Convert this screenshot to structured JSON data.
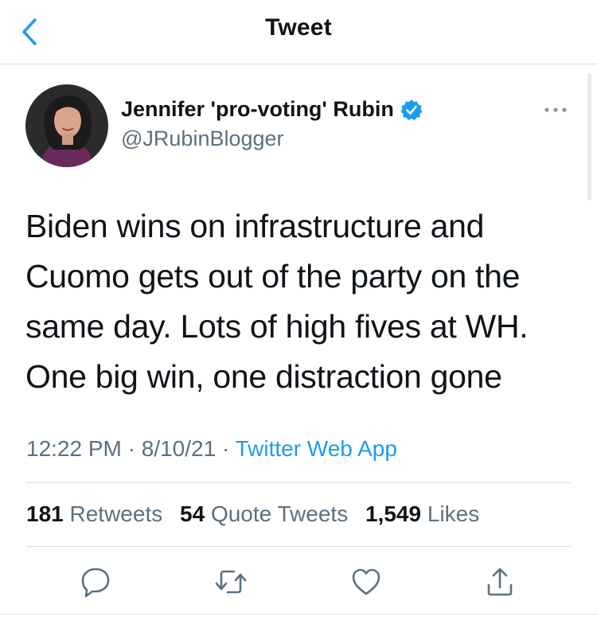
{
  "nav": {
    "title": "Tweet",
    "back_icon": "chevron-left-icon"
  },
  "author": {
    "name": "Jennifer 'pro-voting' Rubin",
    "handle": "@JRubinBlogger",
    "verified": true
  },
  "tweet": {
    "text": "Biden wins on infrastructure and\nCuomo gets out of the party on the\nsame day. Lots of high fives at WH.\nOne big win, one distraction gone",
    "time": "12:22 PM",
    "date": "8/10/21",
    "separator": "·",
    "source": "Twitter Web App"
  },
  "stats": {
    "retweets_count": "181",
    "retweets_label": "Retweets",
    "quotes_count": "54",
    "quotes_label": "Quote Tweets",
    "likes_count": "1,549",
    "likes_label": "Likes"
  },
  "actions": [
    "reply-icon",
    "retweet-icon",
    "like-icon",
    "share-icon"
  ],
  "colors": {
    "accent": "#1d9bf0",
    "secondary_text": "#5b7083",
    "divider": "#d9dde0"
  }
}
